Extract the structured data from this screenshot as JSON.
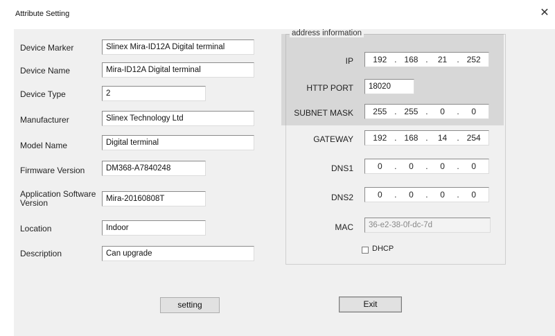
{
  "window": {
    "title": "Attribute Setting",
    "close_glyph": "✕"
  },
  "left_form": [
    {
      "label": "Device Marker",
      "value": "Slinex Mira-ID12A Digital terminal"
    },
    {
      "label": "Device Name",
      "value": "Mira-ID12A Digital terminal"
    },
    {
      "label": "Device Type",
      "value": "2"
    },
    {
      "label": "Manufacturer",
      "value": "Slinex Technology Ltd"
    },
    {
      "label": "Model Name",
      "value": "Digital terminal"
    },
    {
      "label": "Firmware Version",
      "value": "DM368-A7840248"
    },
    {
      "label": "Application Software Version",
      "value": "Mira-20160808T"
    },
    {
      "label": "Location",
      "value": "Indoor"
    },
    {
      "label": "Description",
      "value": "Can upgrade"
    }
  ],
  "address": {
    "legend": "address information",
    "ip": {
      "label": "IP",
      "octets": [
        "192",
        "168",
        "21",
        "252"
      ]
    },
    "http_port": {
      "label": "HTTP PORT",
      "value": "18020"
    },
    "subnet_mask": {
      "label": "SUBNET MASK",
      "octets": [
        "255",
        "255",
        "0",
        "0"
      ]
    },
    "gateway": {
      "label": "GATEWAY",
      "octets": [
        "192",
        "168",
        "14",
        "254"
      ]
    },
    "dns1": {
      "label": "DNS1",
      "octets": [
        "0",
        "0",
        "0",
        "0"
      ]
    },
    "dns2": {
      "label": "DNS2",
      "octets": [
        "0",
        "0",
        "0",
        "0"
      ]
    },
    "mac": {
      "label": "MAC",
      "value": "36-e2-38-0f-dc-7d"
    },
    "dhcp": {
      "label": "DHCP",
      "checked": false
    }
  },
  "buttons": {
    "setting": "setting",
    "exit": "Exit"
  }
}
